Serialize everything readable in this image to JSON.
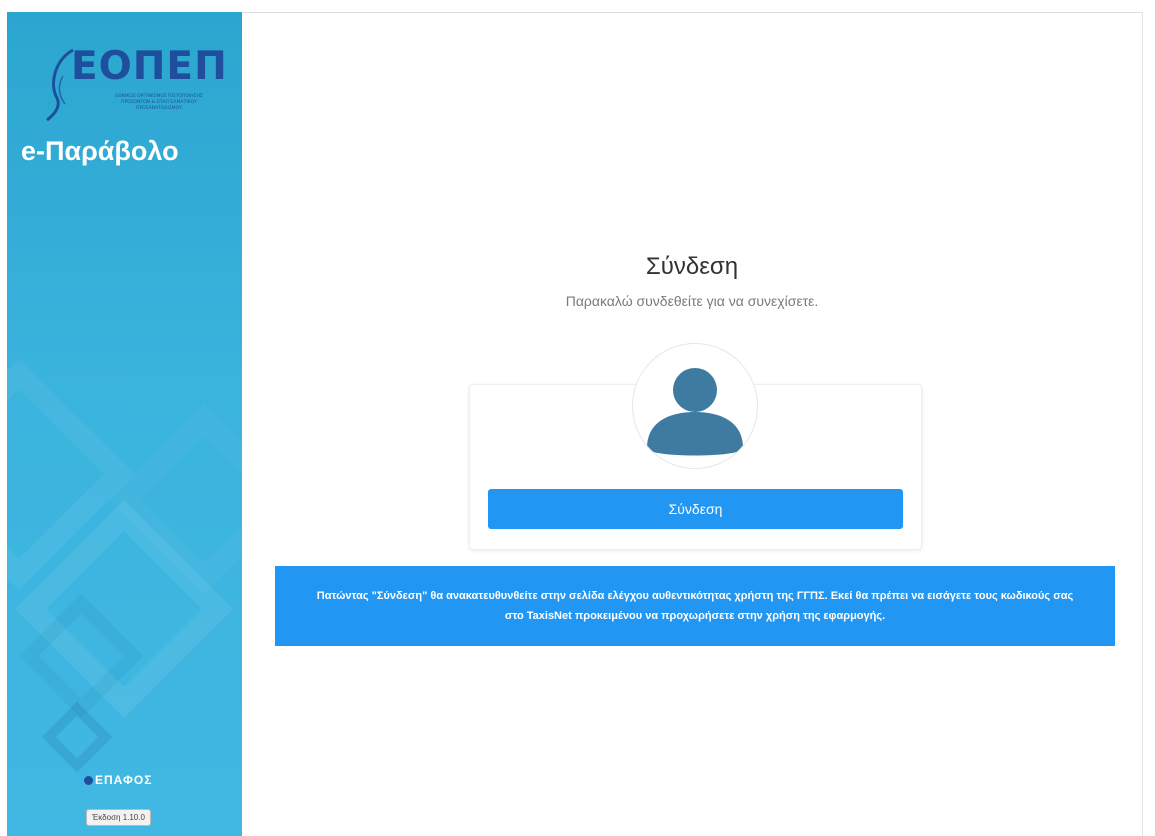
{
  "sidebar": {
    "logo": {
      "text": "ΕΟΠΕΠ",
      "subtitle": "ΕΘΝΙΚΟΣ ΟΡΓΑΝΙΣΜΟΣ ΠΙΣΤΟΠΟΙΗΣΗΣ ΠΡΟΣΟΝΤΩΝ & ΕΠΑΓΓΕΛΜΑΤΙΚΟΥ ΠΡΟΣΑΝΑΤΟΛΙΣΜΟΥ"
    },
    "app_title": "e-Παράβολο",
    "footer_logo": "ΕΠΑΦΟΣ",
    "version": "Έκδοση 1.10.0"
  },
  "login": {
    "title": "Σύνδεση",
    "subtitle": "Παρακαλώ συνδεθείτε για να συνεχίσετε.",
    "avatar_icon": "user-avatar-icon",
    "button_label": "Σύνδεση"
  },
  "info": {
    "before": "Πατώντας \"Σύνδεση\" θα ανακατευθυνθείτε στην σελίδα ελέγχου αυθεντικότητας χρήστη της ΓΓΠΣ. Εκεί θα πρέπει να εισάγετε τους κωδικούς σας στο ",
    "highlight": "TaxisNet",
    "after": " προκειμένου να προχωρήσετε στην χρήση της εφαρμογής."
  },
  "colors": {
    "sidebar": "#3ab3dd",
    "primary": "#2196f3",
    "avatar": "#3f7aa0",
    "logo": "#1f4f9c"
  }
}
